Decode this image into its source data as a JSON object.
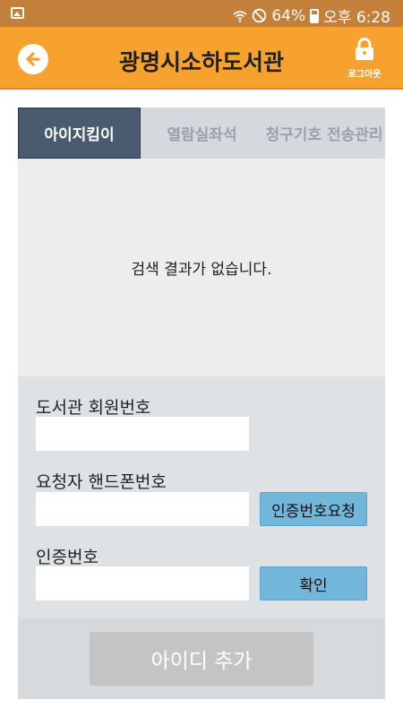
{
  "status_bar": {
    "battery": "64%",
    "time": "오후 6:28",
    "icons": [
      "image-icon",
      "wifi-icon",
      "do-not-disturb-icon",
      "battery-charging-icon"
    ]
  },
  "header": {
    "title": "광명시소하도서관",
    "back_icon": "arrow-left-icon",
    "logout_label": "로그아웃",
    "logout_icon": "lock-icon",
    "color": "#f7a12e"
  },
  "tabs": [
    {
      "label": "아이지킴이",
      "active": true
    },
    {
      "label": "열람실좌석",
      "active": false
    },
    {
      "label": "청구기호 전송관리",
      "active": false
    }
  ],
  "results": {
    "empty_message": "검색 결과가 없습니다."
  },
  "form": {
    "member_label": "도서관 회원번호",
    "member_value": "",
    "phone_label": "요청자 핸드폰번호",
    "phone_value": "",
    "request_button": "인증번호요청",
    "code_label": "인증번호",
    "code_value": "",
    "confirm_button": "확인"
  },
  "footer": {
    "add_button": "아이디 추가"
  },
  "colors": {
    "status_bar": "#c2803b",
    "tab_active": "#4a5b70",
    "action_button": "#72b6dc",
    "add_button_disabled": "#c4c4c4"
  }
}
